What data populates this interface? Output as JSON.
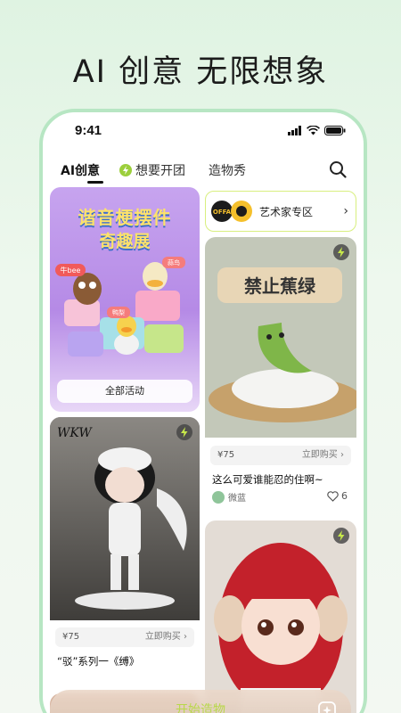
{
  "headline": "AI 创意 无限想象",
  "status_bar": {
    "time": "9:41"
  },
  "tabs": [
    {
      "label": "AI创意",
      "active": true
    },
    {
      "label": "想要开团",
      "active": false
    },
    {
      "label": "造物秀",
      "active": false
    }
  ],
  "banner": {
    "title_line1": "谐音梗摆件",
    "title_line2": "奇趣展",
    "sticker_labels": [
      "牛bee",
      "鸭梨",
      "蒜鸟"
    ],
    "button_label": "全部活动"
  },
  "artist_zone": {
    "logo_text": "OFFA",
    "label": "艺术家专区"
  },
  "products": [
    {
      "image_text": "WKW",
      "price": "¥75",
      "buy_label": "立即购买",
      "title": "“驳”系列一《缚》"
    },
    {
      "image_text": "禁止蕉绿",
      "price": "¥75",
      "buy_label": "立即购买",
      "title": "这么可爱谁能忍的住啊~",
      "author": "微蓝",
      "likes": "6"
    },
    {
      "image_text": "",
      "price": "",
      "buy_label": "",
      "title": ""
    }
  ],
  "cta": {
    "label": "开始造物"
  },
  "colors": {
    "accent": "#b7e6c3",
    "cta_text": "#b8d84a",
    "banner_bg": "#b58ae6"
  }
}
